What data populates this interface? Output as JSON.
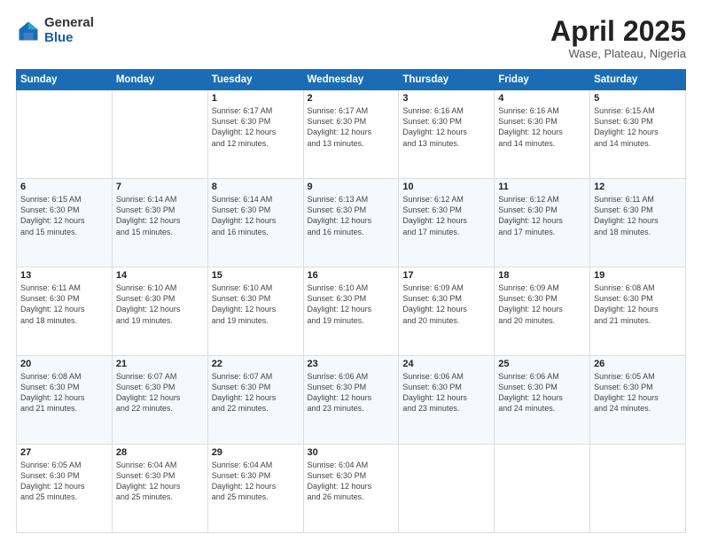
{
  "logo": {
    "general": "General",
    "blue": "Blue"
  },
  "title": {
    "month": "April 2025",
    "location": "Wase, Plateau, Nigeria"
  },
  "header_days": [
    "Sunday",
    "Monday",
    "Tuesday",
    "Wednesday",
    "Thursday",
    "Friday",
    "Saturday"
  ],
  "weeks": [
    [
      {
        "day": "",
        "info": ""
      },
      {
        "day": "",
        "info": ""
      },
      {
        "day": "1",
        "info": "Sunrise: 6:17 AM\nSunset: 6:30 PM\nDaylight: 12 hours\nand 12 minutes."
      },
      {
        "day": "2",
        "info": "Sunrise: 6:17 AM\nSunset: 6:30 PM\nDaylight: 12 hours\nand 13 minutes."
      },
      {
        "day": "3",
        "info": "Sunrise: 6:16 AM\nSunset: 6:30 PM\nDaylight: 12 hours\nand 13 minutes."
      },
      {
        "day": "4",
        "info": "Sunrise: 6:16 AM\nSunset: 6:30 PM\nDaylight: 12 hours\nand 14 minutes."
      },
      {
        "day": "5",
        "info": "Sunrise: 6:15 AM\nSunset: 6:30 PM\nDaylight: 12 hours\nand 14 minutes."
      }
    ],
    [
      {
        "day": "6",
        "info": "Sunrise: 6:15 AM\nSunset: 6:30 PM\nDaylight: 12 hours\nand 15 minutes."
      },
      {
        "day": "7",
        "info": "Sunrise: 6:14 AM\nSunset: 6:30 PM\nDaylight: 12 hours\nand 15 minutes."
      },
      {
        "day": "8",
        "info": "Sunrise: 6:14 AM\nSunset: 6:30 PM\nDaylight: 12 hours\nand 16 minutes."
      },
      {
        "day": "9",
        "info": "Sunrise: 6:13 AM\nSunset: 6:30 PM\nDaylight: 12 hours\nand 16 minutes."
      },
      {
        "day": "10",
        "info": "Sunrise: 6:12 AM\nSunset: 6:30 PM\nDaylight: 12 hours\nand 17 minutes."
      },
      {
        "day": "11",
        "info": "Sunrise: 6:12 AM\nSunset: 6:30 PM\nDaylight: 12 hours\nand 17 minutes."
      },
      {
        "day": "12",
        "info": "Sunrise: 6:11 AM\nSunset: 6:30 PM\nDaylight: 12 hours\nand 18 minutes."
      }
    ],
    [
      {
        "day": "13",
        "info": "Sunrise: 6:11 AM\nSunset: 6:30 PM\nDaylight: 12 hours\nand 18 minutes."
      },
      {
        "day": "14",
        "info": "Sunrise: 6:10 AM\nSunset: 6:30 PM\nDaylight: 12 hours\nand 19 minutes."
      },
      {
        "day": "15",
        "info": "Sunrise: 6:10 AM\nSunset: 6:30 PM\nDaylight: 12 hours\nand 19 minutes."
      },
      {
        "day": "16",
        "info": "Sunrise: 6:10 AM\nSunset: 6:30 PM\nDaylight: 12 hours\nand 19 minutes."
      },
      {
        "day": "17",
        "info": "Sunrise: 6:09 AM\nSunset: 6:30 PM\nDaylight: 12 hours\nand 20 minutes."
      },
      {
        "day": "18",
        "info": "Sunrise: 6:09 AM\nSunset: 6:30 PM\nDaylight: 12 hours\nand 20 minutes."
      },
      {
        "day": "19",
        "info": "Sunrise: 6:08 AM\nSunset: 6:30 PM\nDaylight: 12 hours\nand 21 minutes."
      }
    ],
    [
      {
        "day": "20",
        "info": "Sunrise: 6:08 AM\nSunset: 6:30 PM\nDaylight: 12 hours\nand 21 minutes."
      },
      {
        "day": "21",
        "info": "Sunrise: 6:07 AM\nSunset: 6:30 PM\nDaylight: 12 hours\nand 22 minutes."
      },
      {
        "day": "22",
        "info": "Sunrise: 6:07 AM\nSunset: 6:30 PM\nDaylight: 12 hours\nand 22 minutes."
      },
      {
        "day": "23",
        "info": "Sunrise: 6:06 AM\nSunset: 6:30 PM\nDaylight: 12 hours\nand 23 minutes."
      },
      {
        "day": "24",
        "info": "Sunrise: 6:06 AM\nSunset: 6:30 PM\nDaylight: 12 hours\nand 23 minutes."
      },
      {
        "day": "25",
        "info": "Sunrise: 6:06 AM\nSunset: 6:30 PM\nDaylight: 12 hours\nand 24 minutes."
      },
      {
        "day": "26",
        "info": "Sunrise: 6:05 AM\nSunset: 6:30 PM\nDaylight: 12 hours\nand 24 minutes."
      }
    ],
    [
      {
        "day": "27",
        "info": "Sunrise: 6:05 AM\nSunset: 6:30 PM\nDaylight: 12 hours\nand 25 minutes."
      },
      {
        "day": "28",
        "info": "Sunrise: 6:04 AM\nSunset: 6:30 PM\nDaylight: 12 hours\nand 25 minutes."
      },
      {
        "day": "29",
        "info": "Sunrise: 6:04 AM\nSunset: 6:30 PM\nDaylight: 12 hours\nand 25 minutes."
      },
      {
        "day": "30",
        "info": "Sunrise: 6:04 AM\nSunset: 6:30 PM\nDaylight: 12 hours\nand 26 minutes."
      },
      {
        "day": "",
        "info": ""
      },
      {
        "day": "",
        "info": ""
      },
      {
        "day": "",
        "info": ""
      }
    ]
  ]
}
